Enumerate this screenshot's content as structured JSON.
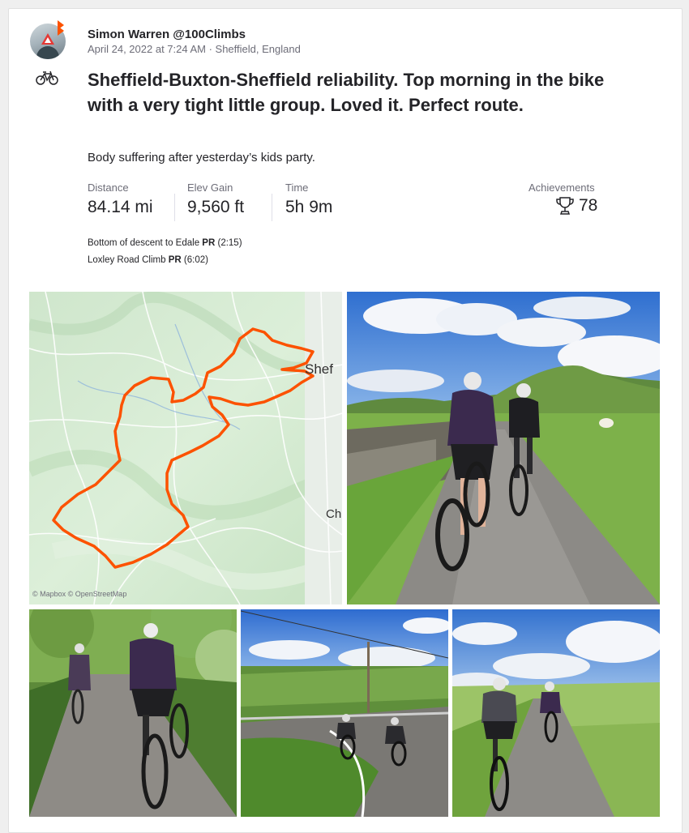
{
  "athlete": {
    "name": "Simon Warren @100Climbs",
    "meta": "April 24, 2022 at 7:24 AM · Sheffield, England"
  },
  "activity": {
    "type_icon": "bike-icon",
    "title": "Sheffield-Buxton-Sheffield reliability. Top morning in the bike with a very tight little group. Loved it. Perfect route.",
    "description": "Body suffering after yesterday’s kids party."
  },
  "stats": [
    {
      "label": "Distance",
      "value": "84.14 mi"
    },
    {
      "label": "Elev Gain",
      "value": "9,560 ft"
    },
    {
      "label": "Time",
      "value": "5h 9m"
    }
  ],
  "achievements": {
    "label": "Achievements",
    "count": "78",
    "icon": "trophy-icon"
  },
  "segments": [
    {
      "name": "Bottom of descent to Edale",
      "badge": "PR",
      "time": "(2:15)"
    },
    {
      "name": "Loxley Road Climb",
      "badge": "PR",
      "time": "(6:02)"
    }
  ],
  "map": {
    "labels": [
      "Shef",
      "Ch"
    ],
    "attribution": "© Mapbox © OpenStreetMap",
    "route_color": "#fc5200"
  },
  "colors": {
    "brand": "#fc5200",
    "text": "#242428",
    "muted": "#6d6d78"
  }
}
